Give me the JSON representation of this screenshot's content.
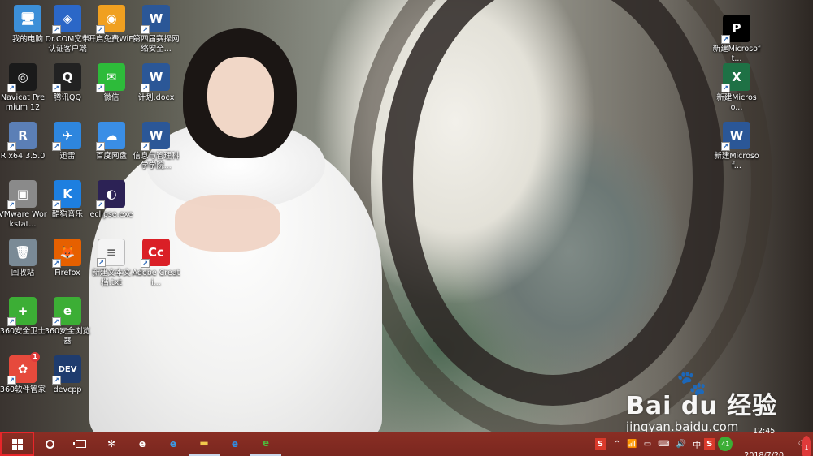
{
  "desktop": {
    "icons": [
      {
        "label": "我的电脑",
        "icon": "computer-icon",
        "color": "#3c8fd8",
        "glyph": "🖥"
      },
      {
        "label": "Dr.COM宽带认证客户端",
        "icon": "drcom-icon",
        "color": "#2b67c7",
        "glyph": "◈"
      },
      {
        "label": "开启免费WiFi",
        "icon": "wifi-icon",
        "color": "#f0a020",
        "glyph": "◉"
      },
      {
        "label": "第四届赛择网络安全...",
        "icon": "word-doc-icon",
        "color": "#2b5797",
        "glyph": "W"
      },
      {
        "label": "Navicat Premium 12",
        "icon": "navicat-icon",
        "color": "#1a1a1a",
        "glyph": "◎"
      },
      {
        "label": "腾讯QQ",
        "icon": "qq-icon",
        "color": "#222222",
        "glyph": "Q"
      },
      {
        "label": "微信",
        "icon": "wechat-icon",
        "color": "#2dbb3a",
        "glyph": "✉"
      },
      {
        "label": "计划.docx",
        "icon": "word-doc-icon",
        "color": "#2b5797",
        "glyph": "W"
      },
      {
        "label": "R x64 3.5.0",
        "icon": "r-icon",
        "color": "#5b7fb6",
        "glyph": "R"
      },
      {
        "label": "迅雷",
        "icon": "xunlei-icon",
        "color": "#2e86de",
        "glyph": "✈"
      },
      {
        "label": "百度网盘",
        "icon": "baidu-netdisk-icon",
        "color": "#3a8ee6",
        "glyph": "☁"
      },
      {
        "label": "信息与管理科学学院...",
        "icon": "word-doc-icon",
        "color": "#2b5797",
        "glyph": "W"
      },
      {
        "label": "VMware Workstat...",
        "icon": "vmware-icon",
        "color": "#8a8a8a",
        "glyph": "▣"
      },
      {
        "label": "酷狗音乐",
        "icon": "kugou-icon",
        "color": "#1d7fe0",
        "glyph": "K"
      },
      {
        "label": "eclipse.exe",
        "icon": "eclipse-icon",
        "color": "#2c2255",
        "glyph": "◐"
      },
      {
        "label": "回收站",
        "icon": "recycle-bin-icon",
        "color": "#7a8a96",
        "glyph": "🗑"
      },
      {
        "label": "Firefox",
        "icon": "firefox-icon",
        "color": "#e66000",
        "glyph": "🦊"
      },
      {
        "label": "新建文本文档.txt",
        "icon": "text-file-icon",
        "color": "#f4f4f4",
        "glyph": "≡"
      },
      {
        "label": "Adobe Creati...",
        "icon": "adobe-cc-icon",
        "color": "#da1f26",
        "glyph": "Cc"
      },
      {
        "label": "360安全卫士",
        "icon": "360-safe-icon",
        "color": "#3cae35",
        "glyph": "+"
      },
      {
        "label": "360安全浏览器",
        "icon": "360-browser-icon",
        "color": "#3cae35",
        "glyph": "e"
      },
      {
        "label": "360软件管家",
        "icon": "360-software-icon",
        "color": "#e64a3c",
        "glyph": "✿",
        "badge": "1"
      },
      {
        "label": "devcpp",
        "icon": "devcpp-icon",
        "color": "#1f3c6e",
        "glyph": "DEV"
      },
      {
        "label": "新建Microsoft...",
        "icon": "powerpoint-icon",
        "color": "#000000",
        "glyph": "P"
      },
      {
        "label": "新建Microso...",
        "icon": "excel-icon",
        "color": "#1e7145",
        "glyph": "X"
      },
      {
        "label": "新建Microsof...",
        "icon": "word-doc-icon",
        "color": "#2b5797",
        "glyph": "W"
      }
    ]
  },
  "watermark": {
    "logo": "Bai du 经验",
    "url": "jingyan.baidu.com"
  },
  "taskbar": {
    "apps": [
      {
        "name": "pinwheel-app-icon",
        "glyph": "✻",
        "color": "#ffffff"
      },
      {
        "name": "ie-icon",
        "glyph": "e",
        "color": "#ffffff"
      },
      {
        "name": "edge-icon",
        "glyph": "e",
        "color": "#3a9be8"
      },
      {
        "name": "file-explorer-icon",
        "glyph": "▬",
        "color": "#f2c94c"
      },
      {
        "name": "ie-blue-icon",
        "glyph": "e",
        "color": "#2f8de4"
      },
      {
        "name": "360-browser-taskbar-icon",
        "glyph": "e",
        "color": "#4cbb3c"
      }
    ],
    "tray": {
      "sogou": "S",
      "wifi": "✈",
      "ime": "中",
      "badge_360": "41",
      "time": "12:45",
      "date": "2018/7/20",
      "notif_count": "1"
    }
  }
}
